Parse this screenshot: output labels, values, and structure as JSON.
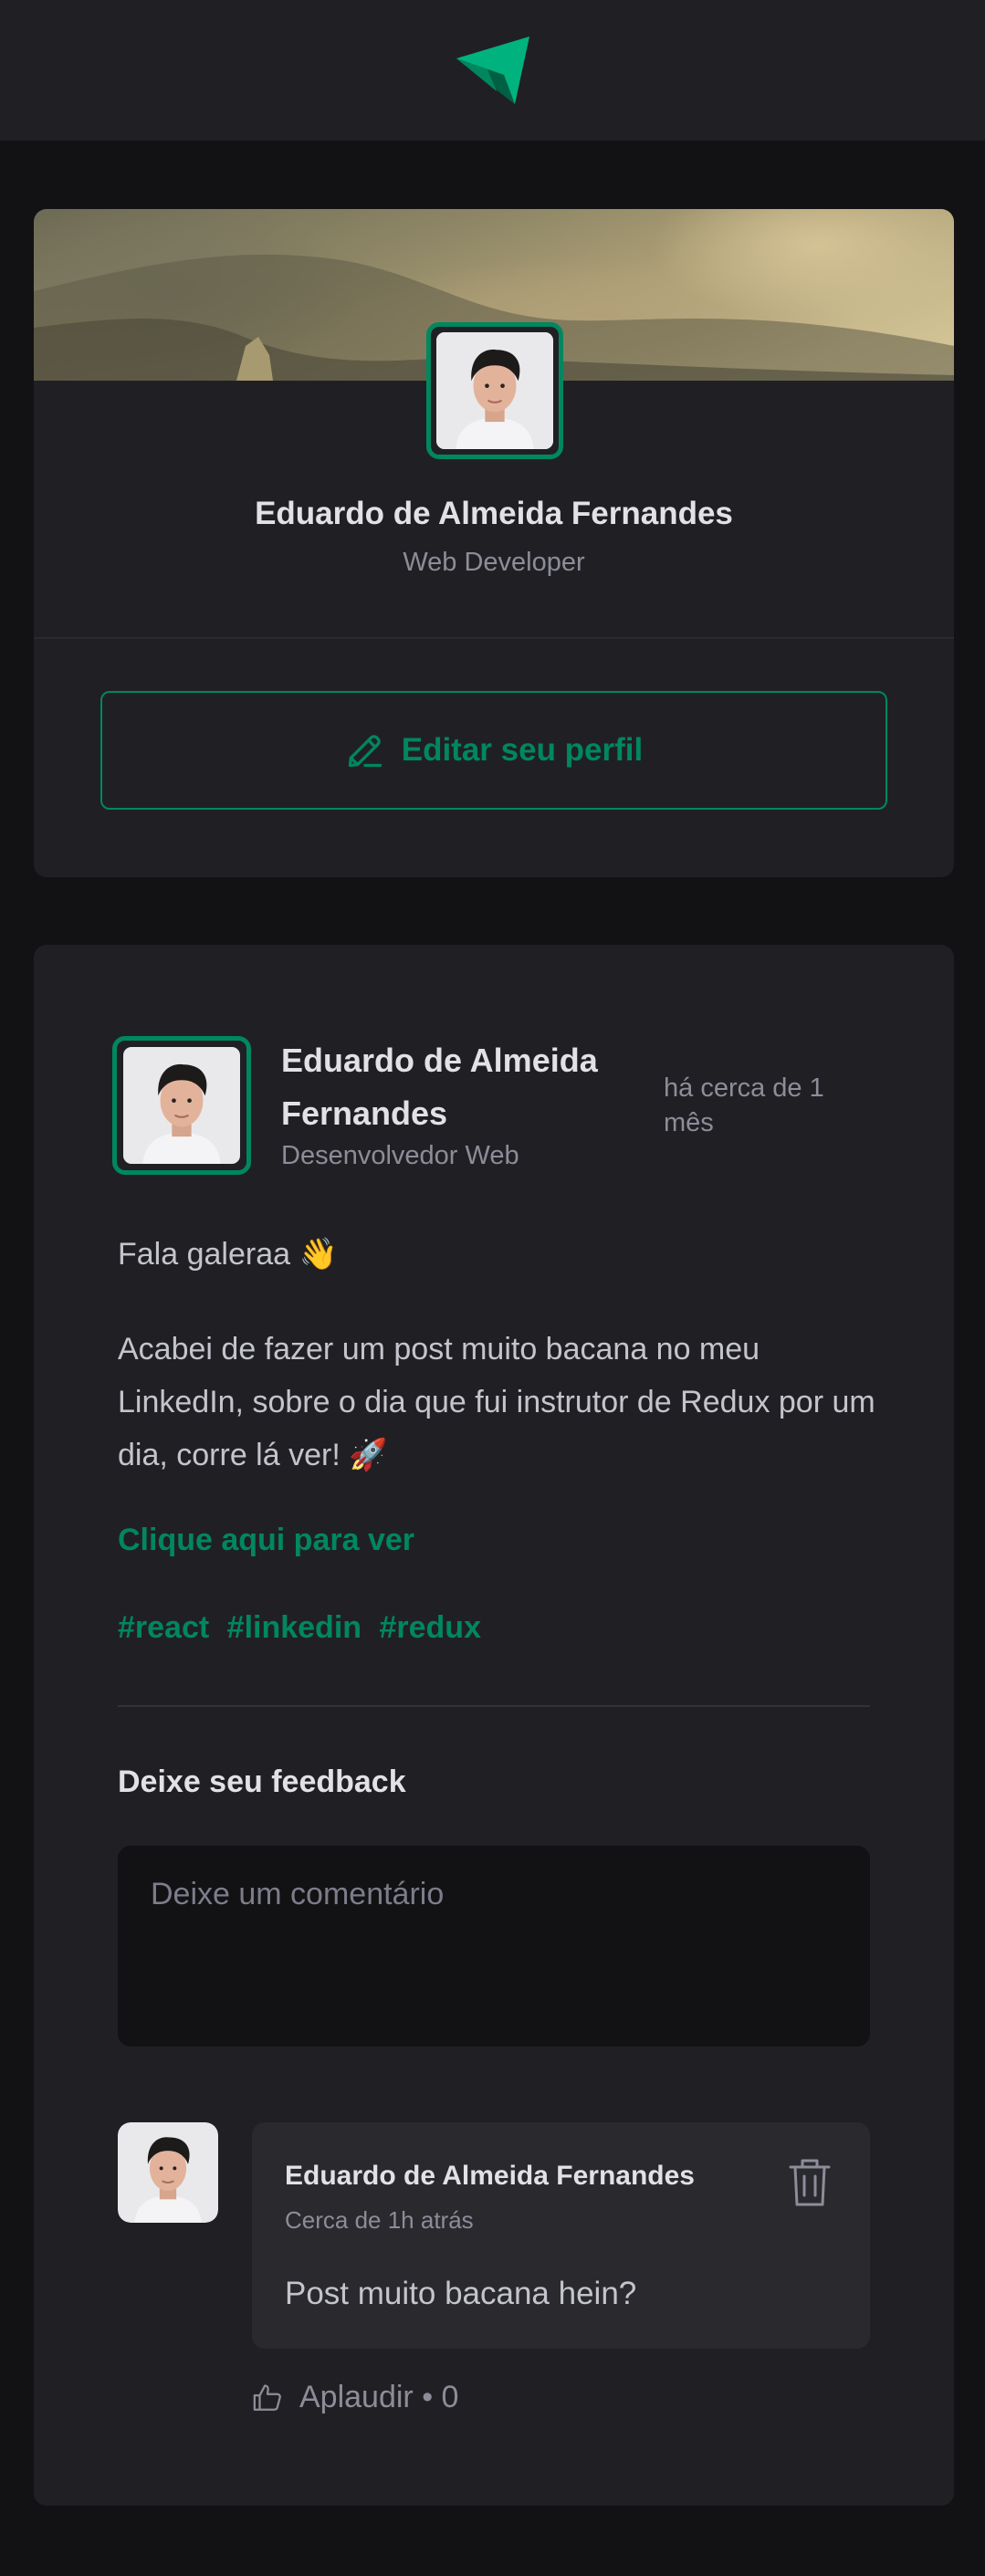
{
  "header": {
    "logo_icon": "paper-plane-logo-icon"
  },
  "profile": {
    "name": "Eduardo de Almeida Fernandes",
    "role": "Web Developer",
    "edit_button_label": "Editar seu perfil",
    "edit_icon": "pencil-icon"
  },
  "post": {
    "author": {
      "name": "Eduardo de Almeida Fernandes",
      "role": "Desenvolvedor Web"
    },
    "published": "há cerca de 1 mês",
    "paragraph_1": "Fala galeraa 👋",
    "paragraph_2": "Acabei de fazer um post muito bacana no meu LinkedIn, sobre o dia que fui instrutor de Redux por um dia, corre lá ver! 🚀",
    "link_text": "Clique aqui para ver",
    "tags": [
      "#react",
      "#linkedin",
      "#redux"
    ],
    "feedback_title": "Deixe seu feedback",
    "comment_placeholder": "Deixe um comentário",
    "comments": [
      {
        "author": "Eduardo de Almeida Fernandes",
        "time": "Cerca de 1h atrás",
        "text": "Post muito bacana hein?",
        "applaud_label": "Aplaudir • 0"
      }
    ]
  },
  "colors": {
    "background": "#121214",
    "card": "#202024",
    "accent": "#00875f",
    "muted_text": "#8d8d99"
  }
}
